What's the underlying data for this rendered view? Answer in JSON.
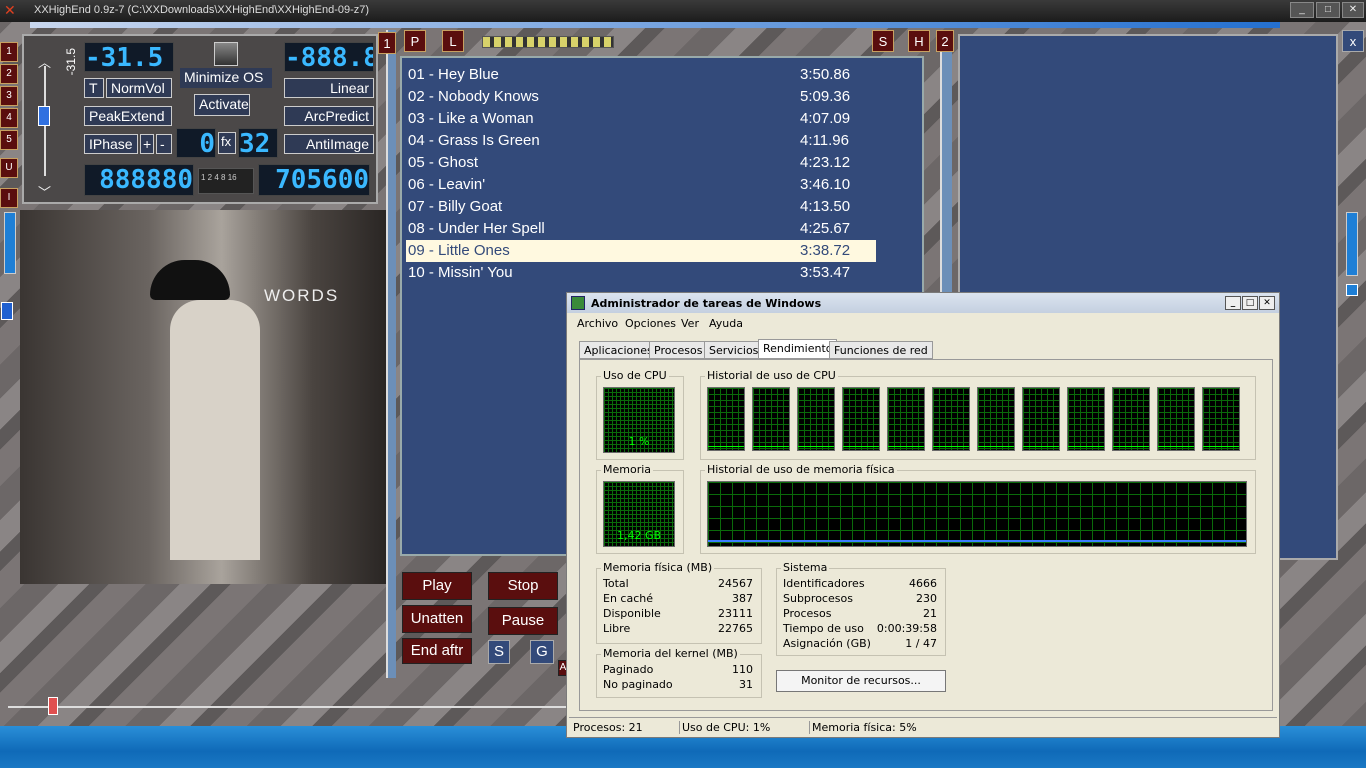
{
  "app": {
    "title": "XXHighEnd 0.9z-7 (C:\\XXDownloads\\XXHighEnd\\XXHighEnd-09-z7)"
  },
  "controls": {
    "volume_lcd": "-31.5",
    "vol_label": "-31.5",
    "right_lcd": "-888.8",
    "minimize_os": "Minimize OS",
    "activate": "Activate",
    "t": "T",
    "normvol": "NormVol",
    "linear": "Linear",
    "peakextend": "PeakExtend",
    "arcpredict": "ArcPredict",
    "iphase": "IPhase",
    "plus": "+",
    "minus": "-",
    "antiimage": "AntiImage",
    "fx_left": "0",
    "fx": "fx",
    "fx_right": "32",
    "counter_lcd": "888880",
    "scale_ticks": "1 2 4 8 16",
    "samplerate_lcd": "705600"
  },
  "side_buttons": [
    "1",
    "2",
    "3",
    "4",
    "5",
    "U",
    "I"
  ],
  "top_buttons": {
    "p": "P",
    "l": "L",
    "s": "S",
    "h": "H",
    "one": "1",
    "two": "2",
    "x": "x"
  },
  "album_text": "WORDS",
  "playlist": [
    {
      "title": "01 - Hey Blue",
      "dur": "3:50.86"
    },
    {
      "title": "02 - Nobody Knows",
      "dur": "5:09.36"
    },
    {
      "title": "03 - Like a Woman",
      "dur": "4:07.09"
    },
    {
      "title": "04 - Grass Is Green",
      "dur": "4:11.96"
    },
    {
      "title": "05 - Ghost",
      "dur": "4:23.12"
    },
    {
      "title": "06 - Leavin'",
      "dur": "3:46.10"
    },
    {
      "title": "07 - Billy Goat",
      "dur": "4:13.50"
    },
    {
      "title": "08 - Under Her Spell",
      "dur": "4:25.67"
    },
    {
      "title": "09 - Little Ones",
      "dur": "3:38.72",
      "selected": true
    },
    {
      "title": "10 - Missin' You",
      "dur": "3:53.47"
    }
  ],
  "transport": {
    "play": "Play",
    "stop": "Stop",
    "unatten": "Unatten",
    "pause": "Pause",
    "end_aftr": "End aftr",
    "s": "S",
    "g": "G",
    "a": "A"
  },
  "taskmgr": {
    "title": "Administrador de tareas de Windows",
    "menu": [
      "Archivo",
      "Opciones",
      "Ver",
      "Ayuda"
    ],
    "tabs": [
      "Aplicaciones",
      "Procesos",
      "Servicios",
      "Rendimiento",
      "Funciones de red"
    ],
    "active_tab": "Rendimiento",
    "cpu_usage_label": "Uso de CPU",
    "cpu_usage_value": "1 %",
    "cpu_history_label": "Historial de uso de CPU",
    "mem_label": "Memoria",
    "mem_value": "1,42 GB",
    "mem_history_label": "Historial de uso de memoria física",
    "phys_mem": {
      "label": "Memoria física (MB)",
      "rows": [
        [
          "Total",
          "24567"
        ],
        [
          "En caché",
          "387"
        ],
        [
          "Disponible",
          "23111"
        ],
        [
          "Libre",
          "22765"
        ]
      ]
    },
    "kernel_mem": {
      "label": "Memoria del kernel (MB)",
      "rows": [
        [
          "Paginado",
          "110"
        ],
        [
          "No paginado",
          "31"
        ]
      ]
    },
    "system": {
      "label": "Sistema",
      "rows": [
        [
          "Identificadores",
          "4666"
        ],
        [
          "Subprocesos",
          "230"
        ],
        [
          "Procesos",
          "21"
        ],
        [
          "Tiempo de uso",
          "0:00:39:58"
        ],
        [
          "Asignación (GB)",
          "1 / 47"
        ]
      ]
    },
    "resource_monitor": "Monitor de recursos...",
    "status": {
      "procesos": "Procesos: 21",
      "cpu": "Uso de CPU: 1%",
      "mem": "Memoria física: 5%"
    },
    "cpu_cores": 12,
    "colors": {
      "graph_line": "#00ff00",
      "mem_line": "#3a7cff"
    }
  }
}
